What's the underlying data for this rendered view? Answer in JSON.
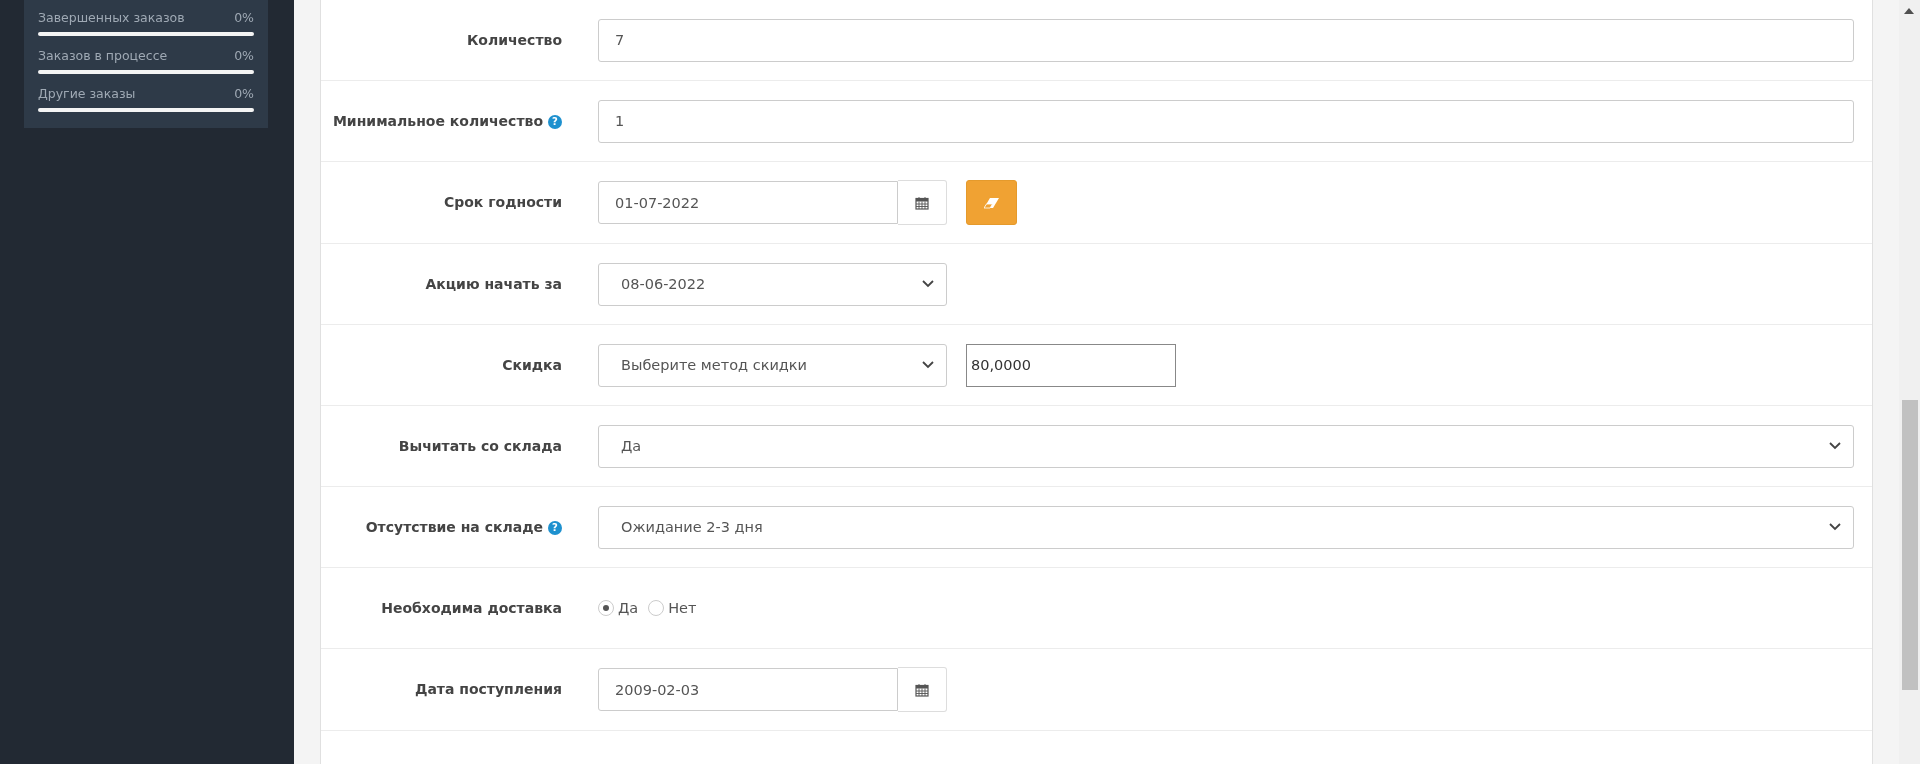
{
  "sidebar": {
    "stats": [
      {
        "label": "Завершенных заказов",
        "value": "0%",
        "level": 0
      },
      {
        "label": "Заказов в процессе",
        "value": "0%",
        "level": 0
      },
      {
        "label": "Другие заказы",
        "value": "0%",
        "level": 0
      }
    ]
  },
  "form": {
    "fields": [
      {
        "kind": "text",
        "label": "Количество",
        "value": "7"
      },
      {
        "kind": "text",
        "label": "Минимальное количество",
        "help": "?",
        "value": "1"
      },
      {
        "kind": "date",
        "label": "Срок годности",
        "value": "01-07-2022",
        "clear_button": true
      },
      {
        "kind": "select_short",
        "label": "Акцию начать за",
        "value": "08-06-2022"
      },
      {
        "kind": "select_input",
        "label": "Скидка",
        "value": "Выберите метод скидки",
        "extra_value": "80,0000"
      },
      {
        "kind": "select",
        "label": "Вычитать со склада",
        "value": "Да"
      },
      {
        "kind": "select",
        "label": "Отсутствие на складе",
        "help": "?",
        "value": "Ожидание 2-3 дня"
      },
      {
        "kind": "radio",
        "label": "Необходима доставка",
        "options": [
          {
            "label": "Да",
            "selected": true
          },
          {
            "label": "Нет",
            "selected": false
          }
        ]
      },
      {
        "kind": "date",
        "label": "Дата поступления",
        "value": "2009-02-03",
        "clear_button": false
      }
    ]
  }
}
